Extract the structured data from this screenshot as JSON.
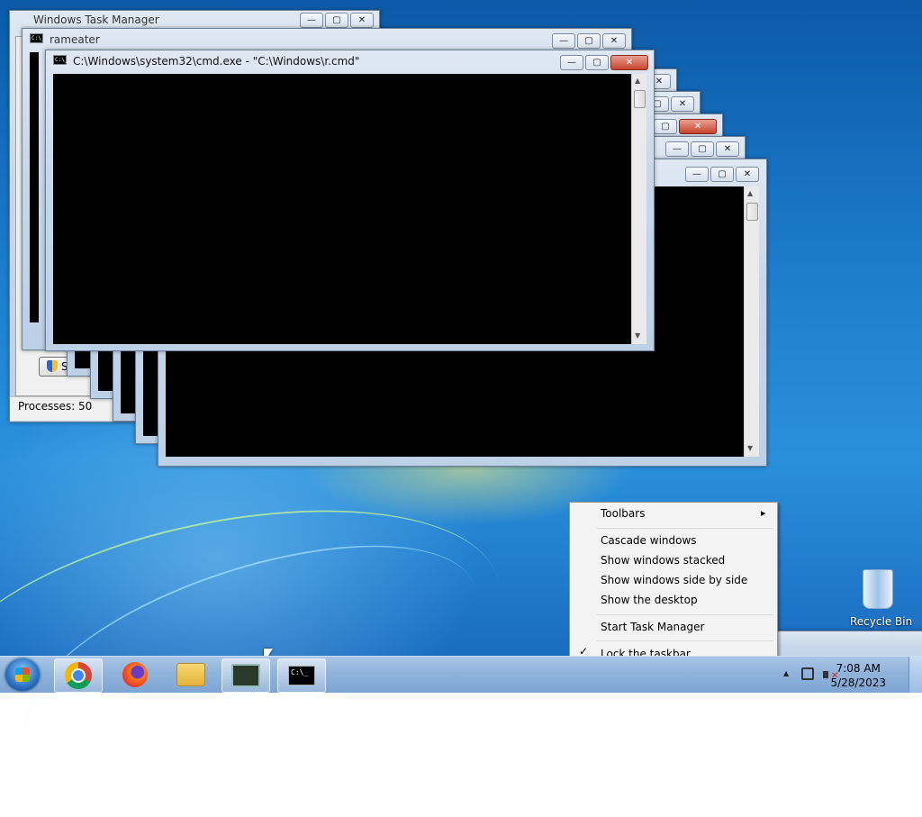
{
  "desktop": {
    "recycle_bin_label": "Recycle Bin"
  },
  "windows": {
    "task_manager_back": {
      "title": "Windows Task Manager",
      "processes_label": "Processes: 50",
      "button_label": "Sh"
    },
    "rameater": {
      "title": "rameater"
    },
    "cmd_front": {
      "title": "C:\\Windows\\system32\\cmd.exe - \"C:\\Windows\\r.cmd\""
    }
  },
  "context_menu": {
    "items": [
      {
        "label": "Toolbars",
        "has_submenu": true
      },
      {
        "label": "Cascade windows"
      },
      {
        "label": "Show windows stacked"
      },
      {
        "label": "Show windows side by side"
      },
      {
        "label": "Show the desktop"
      },
      {
        "label": "Start Task Manager"
      },
      {
        "label": "Lock the taskbar",
        "checked": true
      }
    ]
  },
  "taskbar": {
    "pinned": [
      {
        "name": "chrome-icon"
      },
      {
        "name": "firefox-icon"
      },
      {
        "name": "explorer-icon"
      },
      {
        "name": "task-manager-icon"
      },
      {
        "name": "cmd-icon"
      }
    ],
    "clock": {
      "time": "7:08 AM",
      "date": "5/28/2023"
    }
  },
  "glyphs": {
    "minimize": "—",
    "maximize": "▢",
    "close": "✕",
    "submenu_arrow": "▸",
    "check": "✓",
    "tray_up": "▲",
    "cmd_icon_text": "C:\\_",
    "scroll_up": "▲",
    "scroll_down": "▼"
  },
  "colors": {
    "close_button": "#c7432b",
    "console_background": "#000000"
  }
}
